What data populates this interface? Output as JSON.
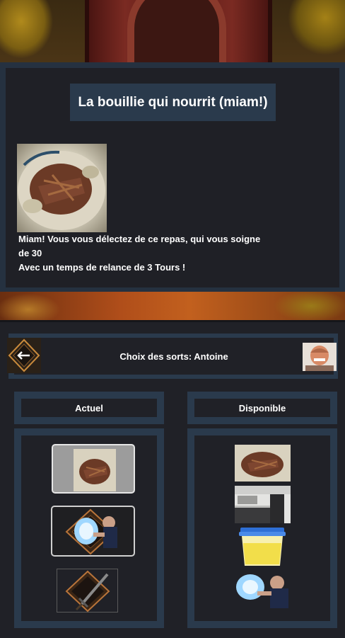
{
  "spell_info": {
    "title": "La bouillie qui nourrit (miam!)",
    "description_lines": [
      "Miam! Vous vous délectez de ce repas, qui vous soigne",
      "de 30",
      "Avec un temps de relance de 3 Tours !"
    ]
  },
  "chooser": {
    "title": "Choix des sorts: Antoine",
    "current_label": "Actuel",
    "available_label": "Disponible",
    "current_slots": [
      {
        "icon": "meal-spell-icon",
        "selected": true
      },
      {
        "icon": "energy-ball-spell-icon",
        "selected": true
      },
      {
        "icon": "sword-spell-icon",
        "selected": false
      }
    ],
    "available_spells": [
      {
        "icon": "meal-spell-icon"
      },
      {
        "icon": "kitchen-spell-icon"
      },
      {
        "icon": "juice-cup-spell-icon"
      },
      {
        "icon": "energy-ball-spell-icon"
      }
    ]
  },
  "colors": {
    "panel_border": "#2a3a4c",
    "panel_bg": "#202127",
    "selected_slot": "#9c9c9c"
  }
}
